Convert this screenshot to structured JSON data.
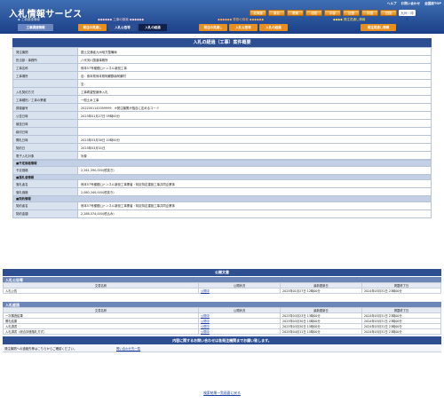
{
  "app": {
    "title": "入札情報サービス",
    "links": [
      "ヘルプ",
      "お問い合わせ",
      "全国版TOP"
    ],
    "regions": [
      "北海道",
      "東北",
      "関東",
      "北陸",
      "中部",
      "近畿",
      "中国",
      "四国",
      "九州・沖縄"
    ],
    "selected_region": "九州・沖縄"
  },
  "tabs": {
    "group1_header": "工事調達情報",
    "group2_header": "工事の検索",
    "group3_header": "業務の検索",
    "group4_header": "発注見通し情報",
    "items": [
      "工事調達情報",
      "発注の見通し",
      "入札公告等",
      "入札の経過",
      "発注の見通し",
      "入札公告等",
      "入札の経過",
      "発注見通し情報"
    ]
  },
  "main": {
    "title": "入札の経過（工事）案件概要",
    "rows": [
      {
        "label": "発注機関",
        "value": "国土交通省九州地方整備局"
      },
      {
        "label": "担当部・事務所",
        "value": "八代河川国道事務所"
      },
      {
        "label": "工事名称",
        "value": "熊本57号種鎧山トンネル新設工事"
      },
      {
        "label": "工事場所",
        "value": "自：熊本県熊本県阿蘇郡南阿蘇村"
      },
      {
        "label": "",
        "value": "至："
      },
      {
        "label": "入札契約方式",
        "value": "工事希望型競争入札"
      },
      {
        "label": "工事種別／工事の業種",
        "value": "一般土木工事"
      },
      {
        "label": "調達番号",
        "value": "2022001143359999　※発注機関が独自に定めるコード"
      },
      {
        "label": "公告日時",
        "value": "2023年01月27日 09時00分"
      },
      {
        "label": "競技日時",
        "value": ""
      },
      {
        "label": "締切日時",
        "value": ""
      },
      {
        "label": "開札日時",
        "value": "2023年03月30日 10時00分"
      },
      {
        "label": "契約日",
        "value": "2023年03月31日"
      },
      {
        "label": "電子入札対象",
        "value": "対象"
      }
    ],
    "section_price": "■予定価格情報",
    "price_rows": [
      {
        "label": "予定価格",
        "value": "2,261,390,000(税抜き)"
      }
    ],
    "section_bidder": "■落札者情報",
    "bidder_rows": [
      {
        "label": "落札者名",
        "value": "熊本57号種鎧山トンネル新設工事業者・特定特定建設工事共同企業体"
      },
      {
        "label": "落札価格",
        "value": "2,080,340,000(税抜き)"
      }
    ],
    "section_contract": "■契約情報",
    "contract_rows": [
      {
        "label": "契約者名",
        "value": "熊本57号種鎧山トンネル新設工事業者・特定特定建設工事共同企業体"
      },
      {
        "label": "契約金額",
        "value": "2,288,374,000(税込み)"
      }
    ]
  },
  "docs": {
    "title": "公開文書",
    "headers": [
      "文書名称",
      "公開状況",
      "最新更新日",
      "掲載終了日"
    ],
    "koukoku_label": "入札公告等",
    "koukoku_rows": [
      {
        "name": "入札公告",
        "status": "公開中",
        "updated": "2023年01月27日 12時00分",
        "end": "2024年03月31日 23時00分"
      }
    ],
    "keika_label": "入札経過",
    "keika_rows": [
      {
        "name": "一次審査結果",
        "status": "公開中",
        "updated": "2023年03月23日 13時00分",
        "end": "2024年03月31日 23時00分"
      },
      {
        "name": "開札結果",
        "status": "公開中",
        "updated": "2023年03月30日 15時00分",
        "end": "2024年03月31日 23時00分"
      },
      {
        "name": "入札調書",
        "status": "公開中",
        "updated": "2023年03月30日 15時00分",
        "end": "2024年03月31日 23時00分"
      },
      {
        "name": "入札調書（総合評価落札方式）",
        "status": "公開中",
        "updated": "2023年04月11日 15時00分",
        "end": "2024年03月31日 23時00分"
      }
    ]
  },
  "footer": {
    "title": "内容に関するお問い合わせは各発注機関までお願い致します。",
    "contact_text": "発注機関への連絡先等はこちらからご確認ください。",
    "contact_link": "問い合わせ先一覧",
    "back_link": "検索結果一覧画面に戻る"
  },
  "colors": {
    "header": "#2d4f92",
    "tab_blue": "#2d4f92",
    "tab_orange": "#e8901f",
    "label_bg": "#d9e3f0"
  }
}
